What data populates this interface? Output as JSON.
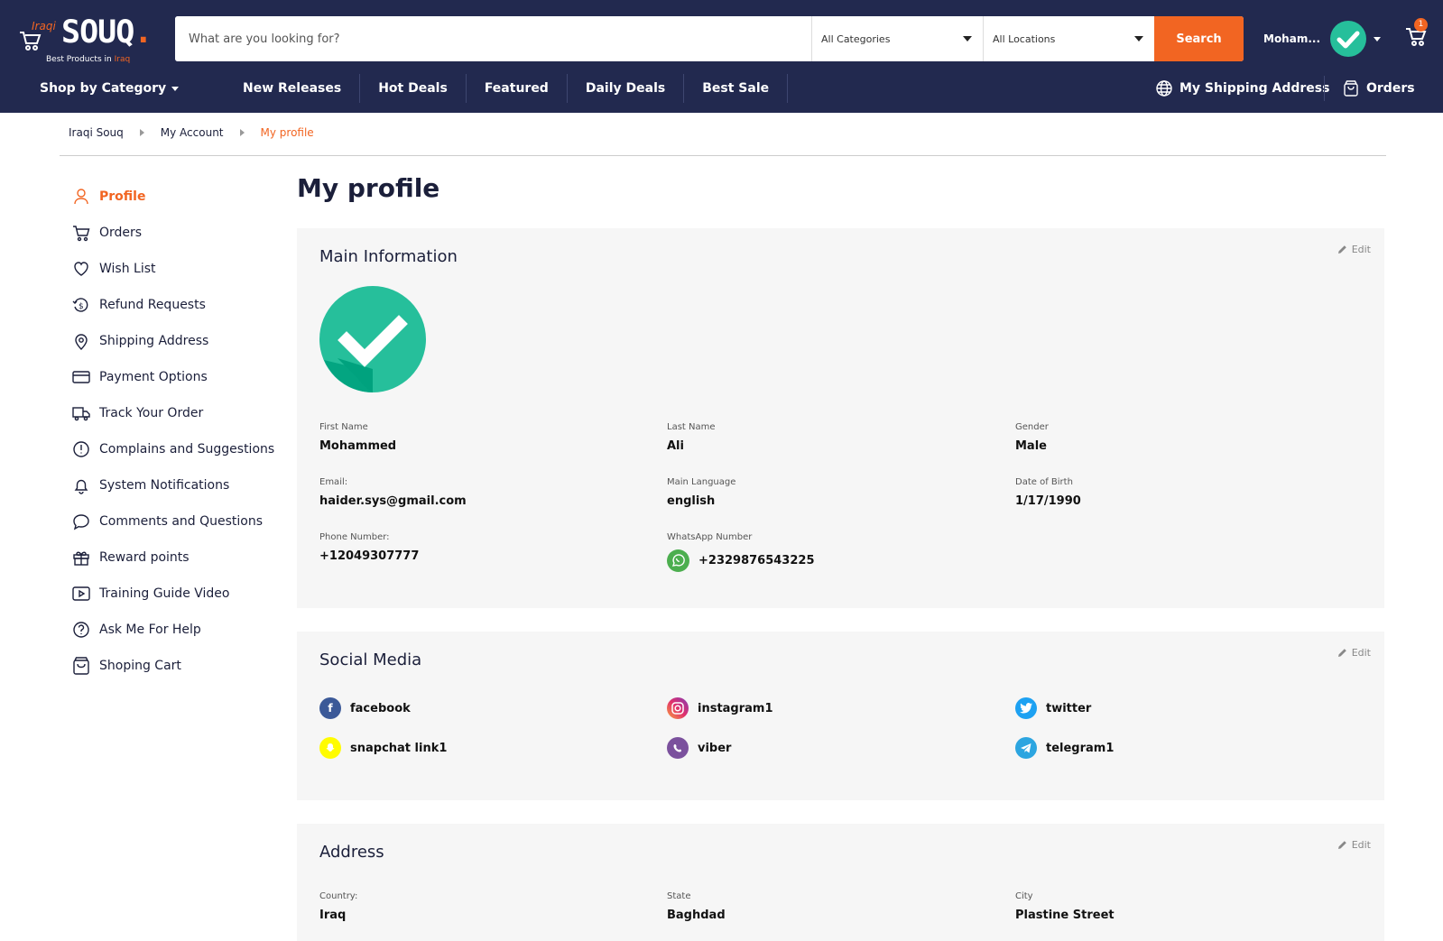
{
  "brand": {
    "tag_prefix": "Iraqi",
    "name": "SOUQ",
    "dot": ".",
    "tagline": "Best Products in",
    "tagline_highlight": "Iraq"
  },
  "search": {
    "placeholder": "What are you looking for?",
    "category": "All Categories",
    "location": "All Locations",
    "button": "Search"
  },
  "user": {
    "name": "Moham...",
    "cart_count": "1"
  },
  "nav": {
    "shop_by_category": "Shop by Category",
    "links": [
      "New Releases",
      "Hot Deals",
      "Featured",
      "Daily Deals",
      "Best Sale"
    ],
    "shipping": "My Shipping Address",
    "orders": "Orders"
  },
  "breadcrumb": [
    "Iraqi Souq",
    "My Account",
    "My profile"
  ],
  "sidebar": {
    "items": [
      {
        "label": "Profile",
        "icon": "user-icon"
      },
      {
        "label": "Orders",
        "icon": "cart-icon"
      },
      {
        "label": "Wish List",
        "icon": "heart-icon"
      },
      {
        "label": "Refund Requests",
        "icon": "refund-icon"
      },
      {
        "label": "Shipping Address",
        "icon": "location-pin-icon"
      },
      {
        "label": "Payment Options",
        "icon": "credit-card-icon"
      },
      {
        "label": "Track Your Order",
        "icon": "truck-icon"
      },
      {
        "label": "Complains and Suggestions",
        "icon": "alert-circle-icon"
      },
      {
        "label": "System Notifications",
        "icon": "bell-icon"
      },
      {
        "label": "Comments and Questions",
        "icon": "chat-bubble-icon"
      },
      {
        "label": "Reward points",
        "icon": "gift-icon"
      },
      {
        "label": "Training Guide Video",
        "icon": "video-icon"
      },
      {
        "label": "Ask Me For Help",
        "icon": "help-circle-icon"
      },
      {
        "label": "Shoping Cart",
        "icon": "shopping-bag-icon"
      }
    ]
  },
  "page": {
    "title": "My profile",
    "edit_label": "Edit"
  },
  "main_info": {
    "title": "Main Information",
    "first_name": {
      "label": "First Name",
      "value": "Mohammed"
    },
    "last_name": {
      "label": "Last Name",
      "value": "Ali"
    },
    "gender": {
      "label": "Gender",
      "value": "Male"
    },
    "email": {
      "label": "Email:",
      "value": "haider.sys@gmail.com"
    },
    "language": {
      "label": "Main Language",
      "value": "english"
    },
    "dob": {
      "label": "Date of Birth",
      "value": "1/17/1990"
    },
    "phone": {
      "label": "Phone Number:",
      "value": "+12049307777"
    },
    "whatsapp": {
      "label": "WhatsApp Number",
      "value": "+2329876543225"
    }
  },
  "social": {
    "title": "Social Media",
    "items": [
      {
        "label": "facebook",
        "icon": "facebook-icon",
        "color": "#3b5998"
      },
      {
        "label": "instagram1",
        "icon": "instagram-icon",
        "color": "#e1306c"
      },
      {
        "label": "twitter",
        "icon": "twitter-icon",
        "color": "#1da1f2"
      },
      {
        "label": "snapchat link1",
        "icon": "snapchat-icon",
        "color": "#fffc00"
      },
      {
        "label": "viber",
        "icon": "viber-icon",
        "color": "#7b519d"
      },
      {
        "label": "telegram1",
        "icon": "telegram-icon",
        "color": "#2ca5e0"
      }
    ]
  },
  "address": {
    "title": "Address",
    "country": {
      "label": "Country:",
      "value": "Iraq"
    },
    "state": {
      "label": "State",
      "value": "Baghdad"
    },
    "city": {
      "label": "City",
      "value": "Plastine Street"
    }
  },
  "colors": {
    "navy": "#22294f",
    "accent": "#f26522",
    "avatar_green": "#26bf9b",
    "card_bg": "#f6f6f6"
  }
}
